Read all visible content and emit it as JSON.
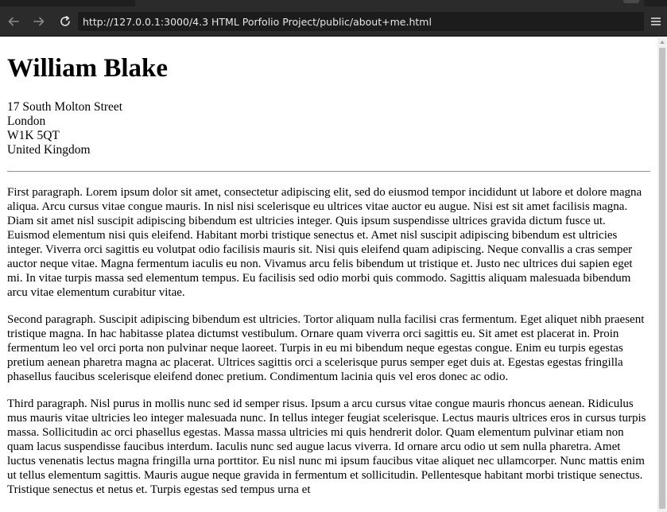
{
  "browser": {
    "url": "http://127.0.0.1:3000/4.3 HTML Porfolio Project/public/about+me.html",
    "icons": {
      "back": "arrow-left-icon",
      "forward": "arrow-right-icon",
      "reload": "reload-icon",
      "menu": "hamburger-menu-icon"
    }
  },
  "page": {
    "name": "William Blake",
    "address_lines": [
      "17 South Molton Street",
      "London",
      "W1K 5QT",
      "United Kingdom"
    ],
    "paragraphs": [
      "First paragraph. Lorem ipsum dolor sit amet, consectetur adipiscing elit, sed do eiusmod tempor incididunt ut labore et dolore magna aliqua. Arcu cursus vitae congue mauris. In nisl nisi scelerisque eu ultrices vitae auctor eu augue. Nisi est sit amet facilisis magna. Diam sit amet nisl suscipit adipiscing bibendum est ultricies integer. Quis ipsum suspendisse ultrices gravida dictum fusce ut. Euismod elementum nisi quis eleifend. Habitant morbi tristique senectus et. Amet nisl suscipit adipiscing bibendum est ultricies integer. Viverra orci sagittis eu volutpat odio facilisis mauris sit. Nisi quis eleifend quam adipiscing. Neque convallis a cras semper auctor neque vitae. Magna fermentum iaculis eu non. Vivamus arcu felis bibendum ut tristique et. Justo nec ultrices dui sapien eget mi. In vitae turpis massa sed elementum tempus. Eu facilisis sed odio morbi quis commodo. Sagittis aliquam malesuada bibendum arcu vitae elementum curabitur vitae.",
      "Second paragraph. Suscipit adipiscing bibendum est ultricies. Tortor aliquam nulla facilisi cras fermentum. Eget aliquet nibh praesent tristique magna. In hac habitasse platea dictumst vestibulum. Ornare quam viverra orci sagittis eu. Sit amet est placerat in. Proin fermentum leo vel orci porta non pulvinar neque laoreet. Turpis in eu mi bibendum neque egestas congue. Enim eu turpis egestas pretium aenean pharetra magna ac placerat. Ultrices sagittis orci a scelerisque purus semper eget duis at. Egestas egestas fringilla phasellus faucibus scelerisque eleifend donec pretium. Condimentum lacinia quis vel eros donec ac odio.",
      "Third paragraph. Nisl purus in mollis nunc sed id semper risus. Ipsum a arcu cursus vitae congue mauris rhoncus aenean. Ridiculus mus mauris vitae ultricies leo integer malesuada nunc. In tellus integer feugiat scelerisque. Lectus mauris ultrices eros in cursus turpis massa. Sollicitudin ac orci phasellus egestas. Massa massa ultricies mi quis hendrerit dolor. Quam elementum pulvinar etiam non quam lacus suspendisse faucibus interdum. Iaculis nunc sed augue lacus viverra. Id ornare arcu odio ut sem nulla pharetra. Amet luctus venenatis lectus magna fringilla urna porttitor. Eu nisl nunc mi ipsum faucibus vitae aliquet nec ullamcorper. Nunc mattis enim ut tellus elementum sagittis. Mauris augue neque gravida in fermentum et sollicitudin. Pellentesque habitant morbi tristique senectus. Tristique senectus et netus et. Turpis egestas sed tempus urna et"
    ]
  }
}
